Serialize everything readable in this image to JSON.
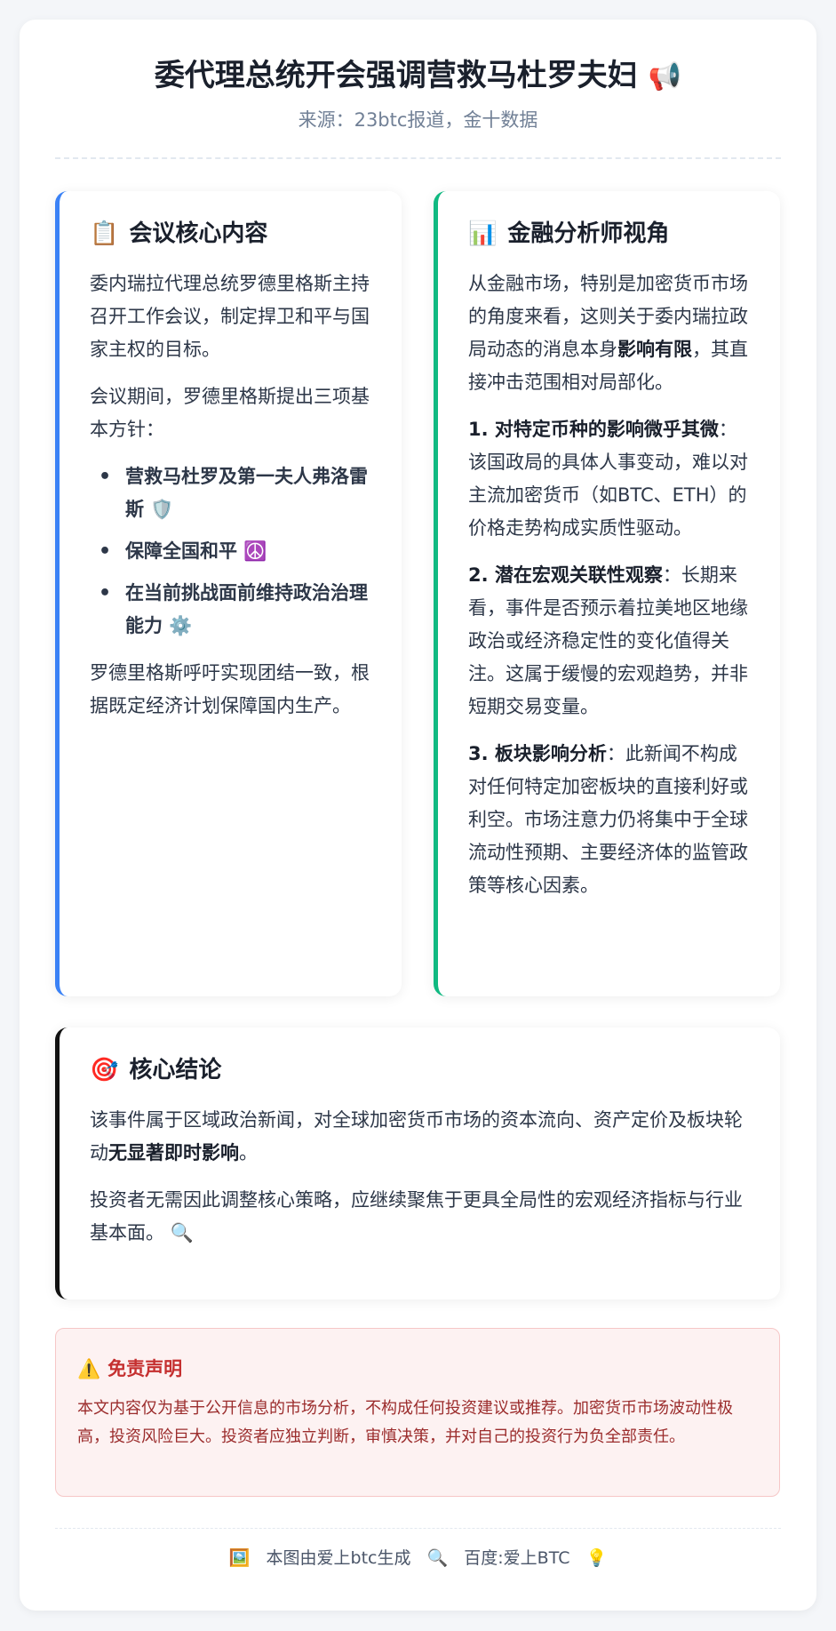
{
  "header": {
    "title": "委代理总统开会强调营救马杜罗夫妇",
    "title_icon": "📢",
    "source": "来源：23btc报道，金十数据"
  },
  "meeting": {
    "icon": "📋",
    "heading": "会议核心内容",
    "p1": "委内瑞拉代理总统罗德里格斯主持召开工作会议，制定捍卫和平与国家主权的目标。",
    "p2": "会议期间，罗德里格斯提出三项基本方针：",
    "items": [
      {
        "text": "营救马杜罗及第一夫人弗洛雷斯",
        "icon": "🛡️"
      },
      {
        "text": "保障全国和平",
        "icon": "☮️"
      },
      {
        "text": "在当前挑战面前维持政治治理能力",
        "icon": "⚙️"
      }
    ],
    "p3": "罗德里格斯呼吁实现团结一致，根据既定经济计划保障国内生产。"
  },
  "analyst": {
    "icon": "📊",
    "heading": "金融分析师视角",
    "intro_a": "从金融市场，特别是加密货币市场的角度来看，这则关于委内瑞拉政局动态的消息本身",
    "intro_b": "影响有限",
    "intro_c": "，其直接冲击范围相对局部化。",
    "points": [
      {
        "title": "1. 对特定币种的影响微乎其微",
        "text": "：该国政局的具体人事变动，难以对主流加密货币（如BTC、ETH）的价格走势构成实质性驱动。"
      },
      {
        "title": "2. 潜在宏观关联性观察",
        "text": "：长期来看，事件是否预示着拉美地区地缘政治或经济稳定性的变化值得关注。这属于缓慢的宏观趋势，并非短期交易变量。"
      },
      {
        "title": "3. 板块影响分析",
        "text": "：此新闻不构成对任何特定加密板块的直接利好或利空。市场注意力仍将集中于全球流动性预期、主要经济体的监管政策等核心因素。"
      }
    ]
  },
  "conclusion": {
    "icon": "🎯",
    "heading": "核心结论",
    "p1_a": "该事件属于区域政治新闻，对全球加密货币市场的资本流向、资产定价及板块轮动",
    "p1_b": "无显著即时影响",
    "p1_c": "。",
    "p2": "投资者无需因此调整核心策略，应继续聚焦于更具全局性的宏观经济指标与行业基本面。",
    "p2_icon": "🔍"
  },
  "disclaimer": {
    "icon": "⚠️",
    "heading": "免责声明",
    "text": "本文内容仅为基于公开信息的市场分析，不构成任何投资建议或推荐。加密货币市场波动性极高，投资风险巨大。投资者应独立判断，审慎决策，并对自己的投资行为负全部责任。"
  },
  "footer": {
    "icon1": "🖼️",
    "text1": "本图由爱上btc生成",
    "icon2": "🔍",
    "text2": "百度:爱上BTC",
    "icon3": "💡"
  }
}
